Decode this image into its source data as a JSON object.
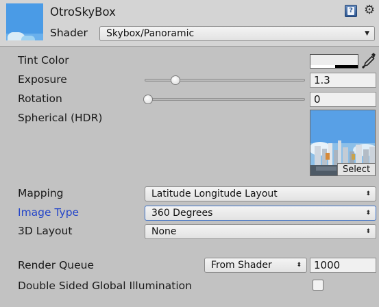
{
  "header": {
    "material_name": "OtroSkyBox",
    "shader_label": "Shader",
    "shader_value": "Skybox/Panoramic"
  },
  "properties": {
    "tint_color_label": "Tint Color",
    "exposure_label": "Exposure",
    "exposure_value": "1.3",
    "exposure_slider_fraction": 0.18,
    "rotation_label": "Rotation",
    "rotation_value": "0",
    "rotation_slider_fraction": 0.0,
    "spherical_label": "Spherical  (HDR)",
    "texture_select_label": "Select",
    "mapping_label": "Mapping",
    "mapping_value": "Latitude Longitude Layout",
    "image_type_label": "Image Type",
    "image_type_value": "360 Degrees",
    "layout_3d_label": "3D Layout",
    "layout_3d_value": "None",
    "render_queue_label": "Render Queue",
    "render_queue_mode": "From Shader",
    "render_queue_value": "1000",
    "double_sided_gi_label": "Double Sided Global Illumination",
    "double_sided_gi_checked": false
  },
  "icons": {
    "help": "help-book-icon",
    "settings": "gear-icon",
    "eyedropper": "eyedropper-icon",
    "dropdown_arrow": "dropdown-arrow-icon"
  },
  "colors": {
    "panel_bg": "#c2c2c2",
    "header_bg": "#d4d4d4",
    "highlight_label": "#2445c8",
    "focus_border": "#3a70c8",
    "sky_blue": "#4a9be6"
  }
}
